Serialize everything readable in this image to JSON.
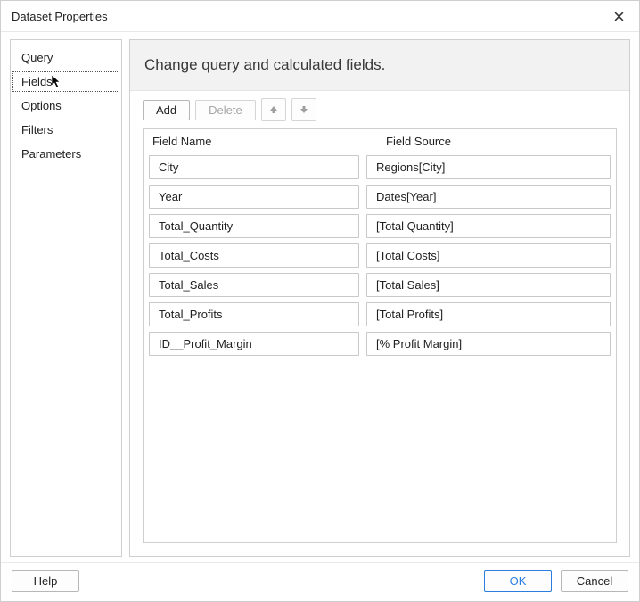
{
  "dialog": {
    "title": "Dataset Properties"
  },
  "sidebar": {
    "items": [
      {
        "label": "Query"
      },
      {
        "label": "Fields"
      },
      {
        "label": "Options"
      },
      {
        "label": "Filters"
      },
      {
        "label": "Parameters"
      }
    ],
    "selected_index": 1
  },
  "main": {
    "heading": "Change query and calculated fields.",
    "toolbar": {
      "add_label": "Add",
      "delete_label": "Delete"
    },
    "grid": {
      "headers": {
        "name": "Field Name",
        "source": "Field Source"
      },
      "rows": [
        {
          "name": "City",
          "source": "Regions[City]"
        },
        {
          "name": "Year",
          "source": "Dates[Year]"
        },
        {
          "name": "Total_Quantity",
          "source": "[Total Quantity]"
        },
        {
          "name": "Total_Costs",
          "source": "[Total Costs]"
        },
        {
          "name": "Total_Sales",
          "source": "[Total Sales]"
        },
        {
          "name": "Total_Profits",
          "source": "[Total Profits]"
        },
        {
          "name": "ID__Profit_Margin",
          "source": "[% Profit Margin]"
        }
      ]
    }
  },
  "footer": {
    "help_label": "Help",
    "ok_label": "OK",
    "cancel_label": "Cancel"
  }
}
